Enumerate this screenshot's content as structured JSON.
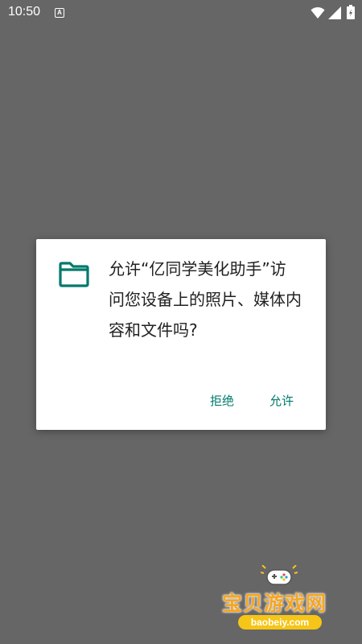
{
  "status_bar": {
    "time": "10:50",
    "notification_icon": "a-letter-icon",
    "notification_letter": "A",
    "icons": [
      "wifi-icon",
      "cellular-signal-icon",
      "battery-icon"
    ]
  },
  "dialog": {
    "icon": "folder-icon",
    "accent_color": "#00796b",
    "message": "允许“亿同学美化助手”访问您设备上的照片、媒体内容和文件吗?",
    "deny_label": "拒绝",
    "allow_label": "允许"
  },
  "watermark": {
    "title": "宝贝游戏网",
    "url": "baobeiy.com"
  }
}
